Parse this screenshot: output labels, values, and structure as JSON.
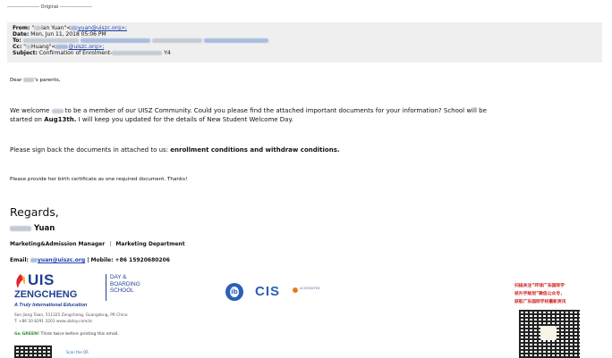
{
  "header": {
    "separator": "-------------------- Original --------------------",
    "from_label": "From:",
    "from_value_a": "\"",
    "from_value_b": "ian Yuan\"<",
    "from_value_c": "yuan@uiszc.org>;",
    "date_label": "Date:",
    "date_value": "Mon, Jun 11, 2018 05:06 PM",
    "to_label": "To:",
    "cc_label": "Cc:",
    "cc_value_a": "\"",
    "cc_value_b": "Huang\"<",
    "cc_value_c": "@uiszc.org>;",
    "subject_label": "Subject:",
    "subject_value": "Confirmation of Enrolment-",
    "subject_suffix": "Y4"
  },
  "body": {
    "greeting_a": "Dear ",
    "greeting_b": "'s parents,",
    "p1_a": "We welcome ",
    "p1_b": " to be a member of our UISZ Community. Could you please find the attached important documents for your information? School will be",
    "p1_c": "started on ",
    "p1_bold": "Aug13th.",
    "p1_d": " I will keep you updated for the details of New Student Welcome Day.",
    "p2_a": "Please sign back the documents in attached to us: ",
    "p2_bold": "enrollment conditions and withdraw conditions.",
    "p3": "Please provide her birth certificate as one required document. Thanks!"
  },
  "signature": {
    "regards": "Regards,",
    "name": "Yuan",
    "title": "Marketing&Admission Manager",
    "divider": "|",
    "department": "Marketing Department",
    "email_label": "Email: ",
    "email_link": "yuan@uiszc.org",
    "mobile": " | Mobile: +86 15920680206"
  },
  "logo": {
    "uis": "UIS",
    "zengcheng": "ZENGCHENG",
    "day_line1": "DAY &",
    "day_line2": "BOARDING",
    "day_line3": "SCHOOL",
    "tagline": "A Truly International Education",
    "address": "San Jiang Town, 511325 Zengcheng, Guangdong, PR China",
    "contact": "T: +86 20 8291 3201  www.ubiloy.com/zc",
    "green_bold": "Go GREEN!",
    "green_rest": " Think twice before printing this email.",
    "scan": "Scan the QR"
  },
  "accreditation": {
    "ib": "ib",
    "cis": "CIS",
    "cis_sub": "ACCREDITED"
  },
  "promo": {
    "line1": "扫描关注“环球广东国际学",
    "line2": "校升学规划”微信公众号，",
    "line3": "获取广东国际学校最新资讯"
  },
  "colors": {
    "brand_blue": "#1f3f93",
    "link_blue": "#1a3fb0",
    "promo_red": "#d11a1a",
    "green": "#2e8b3d"
  }
}
